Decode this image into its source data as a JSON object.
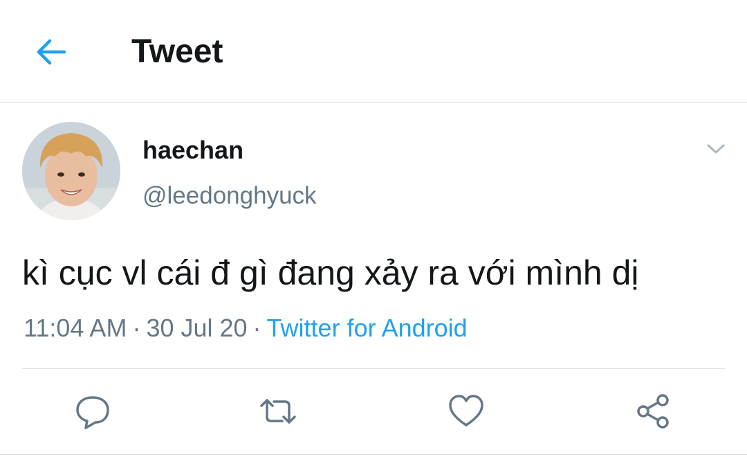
{
  "header": {
    "title": "Tweet",
    "back_icon": "arrow-left-icon",
    "accent_color": "#1da1f2"
  },
  "tweet": {
    "display_name": "haechan",
    "handle": "@leedonghyuck",
    "text": "kì cục vl cái đ gì đang xảy ra với mình dị",
    "time": "11:04 AM",
    "date": "30 Jul 20",
    "source": "Twitter for Android",
    "separator": "·"
  },
  "actions": [
    {
      "name": "reply",
      "icon": "reply-icon"
    },
    {
      "name": "retweet",
      "icon": "retweet-icon"
    },
    {
      "name": "like",
      "icon": "heart-icon"
    },
    {
      "name": "share",
      "icon": "share-icon"
    }
  ],
  "colors": {
    "text_primary": "#14171a",
    "text_secondary": "#657786",
    "divider": "#d9dee2",
    "link": "#1da1f2"
  }
}
